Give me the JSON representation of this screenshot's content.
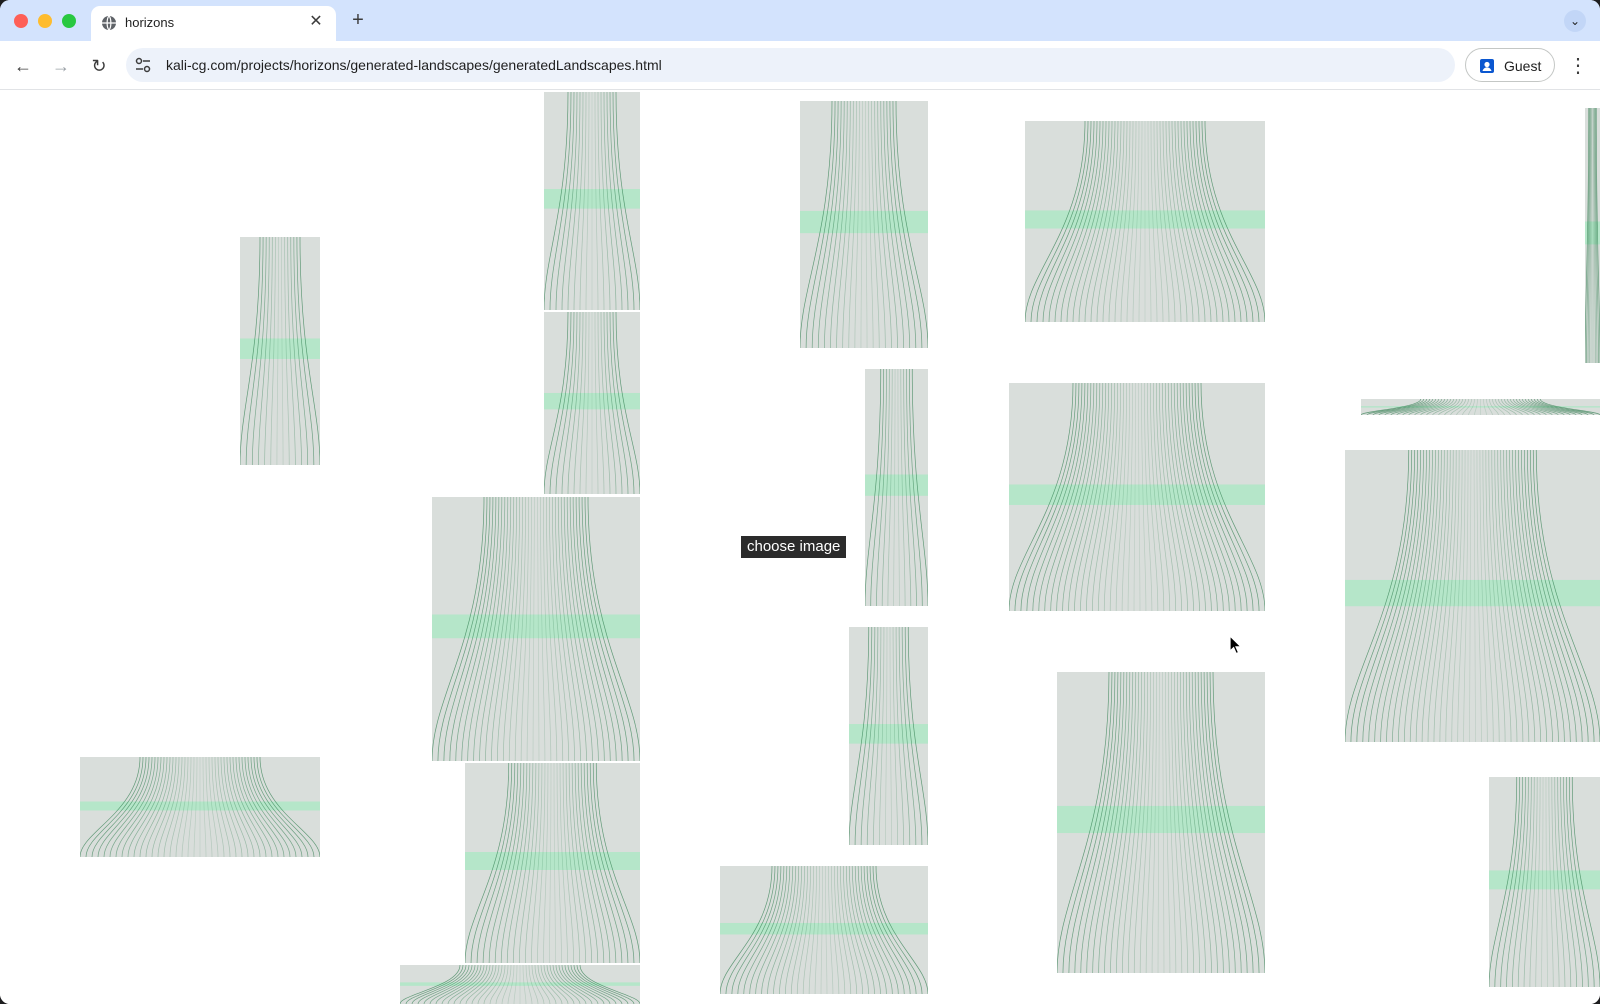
{
  "browser": {
    "tab_title": "horizons",
    "url": "kali-cg.com/projects/horizons/generated-landscapes/generatedLandscapes.html",
    "profile_label": "Guest",
    "accent_color": "#d3e3fd"
  },
  "page": {
    "choose_button_label": "choose image",
    "tile_palette": {
      "background": "#d9dedb",
      "line": "#2f7d4f",
      "horizon": "#8af0b4"
    },
    "tile_count": 22
  }
}
